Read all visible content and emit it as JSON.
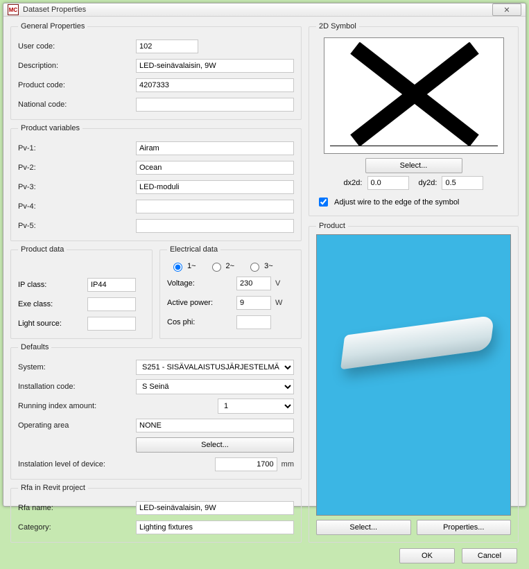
{
  "window": {
    "title": "Dataset Properties",
    "icon_text": "MC"
  },
  "general": {
    "legend": "General Properties",
    "user_code_label": "User code:",
    "user_code": "102",
    "description_label": "Description:",
    "description": "LED-seinävalaisin, 9W",
    "product_code_label": "Product code:",
    "product_code": "4207333",
    "national_code_label": "National code:",
    "national_code": ""
  },
  "pv": {
    "legend": "Product variables",
    "pv1_label": "Pv-1:",
    "pv1": "Airam",
    "pv2_label": "Pv-2:",
    "pv2": "Ocean",
    "pv3_label": "Pv-3:",
    "pv3": "LED-moduli",
    "pv4_label": "Pv-4:",
    "pv4": "",
    "pv5_label": "Pv-5:",
    "pv5": ""
  },
  "pd": {
    "legend": "Product data",
    "ip_label": "IP class:",
    "ip": "IP44",
    "exe_label": "Exe class:",
    "exe": "",
    "ls_label": "Light source:",
    "ls": ""
  },
  "ed": {
    "legend": "Electrical data",
    "phase_1": "1~",
    "phase_2": "2~",
    "phase_3": "3~",
    "voltage_label": "Voltage:",
    "voltage": "230",
    "voltage_unit": "V",
    "ap_label": "Active power:",
    "ap": "9",
    "ap_unit": "W",
    "cos_label": "Cos phi:",
    "cos": ""
  },
  "defaults": {
    "legend": "Defaults",
    "system_label": "System:",
    "system": "S251 - SISÄVALAISTUSJÄRJESTELMÄ",
    "install_label": "Installation code:",
    "install": "S Seinä",
    "ria_label": "Running index amount:",
    "ria": "1",
    "oa_label": "Operating area",
    "oa": "NONE",
    "select_label": "Select...",
    "ilod_label": "Instalation level of device:",
    "ilod": "1700",
    "ilod_unit": "mm"
  },
  "rfa": {
    "legend": "Rfa in Revit project",
    "name_label": "Rfa name:",
    "name": "LED-seinävalaisin, 9W",
    "cat_label": "Category:",
    "cat": "Lighting fixtures"
  },
  "symbol": {
    "legend": "2D Symbol",
    "select_label": "Select...",
    "dx_label": "dx2d:",
    "dx": "0.0",
    "dy_label": "dy2d:",
    "dy": "0.5",
    "adjust_label": "Adjust wire to the edge of the symbol"
  },
  "product": {
    "legend": "Product",
    "select_label": "Select...",
    "props_label": "Properties..."
  },
  "footer": {
    "ok": "OK",
    "cancel": "Cancel"
  }
}
